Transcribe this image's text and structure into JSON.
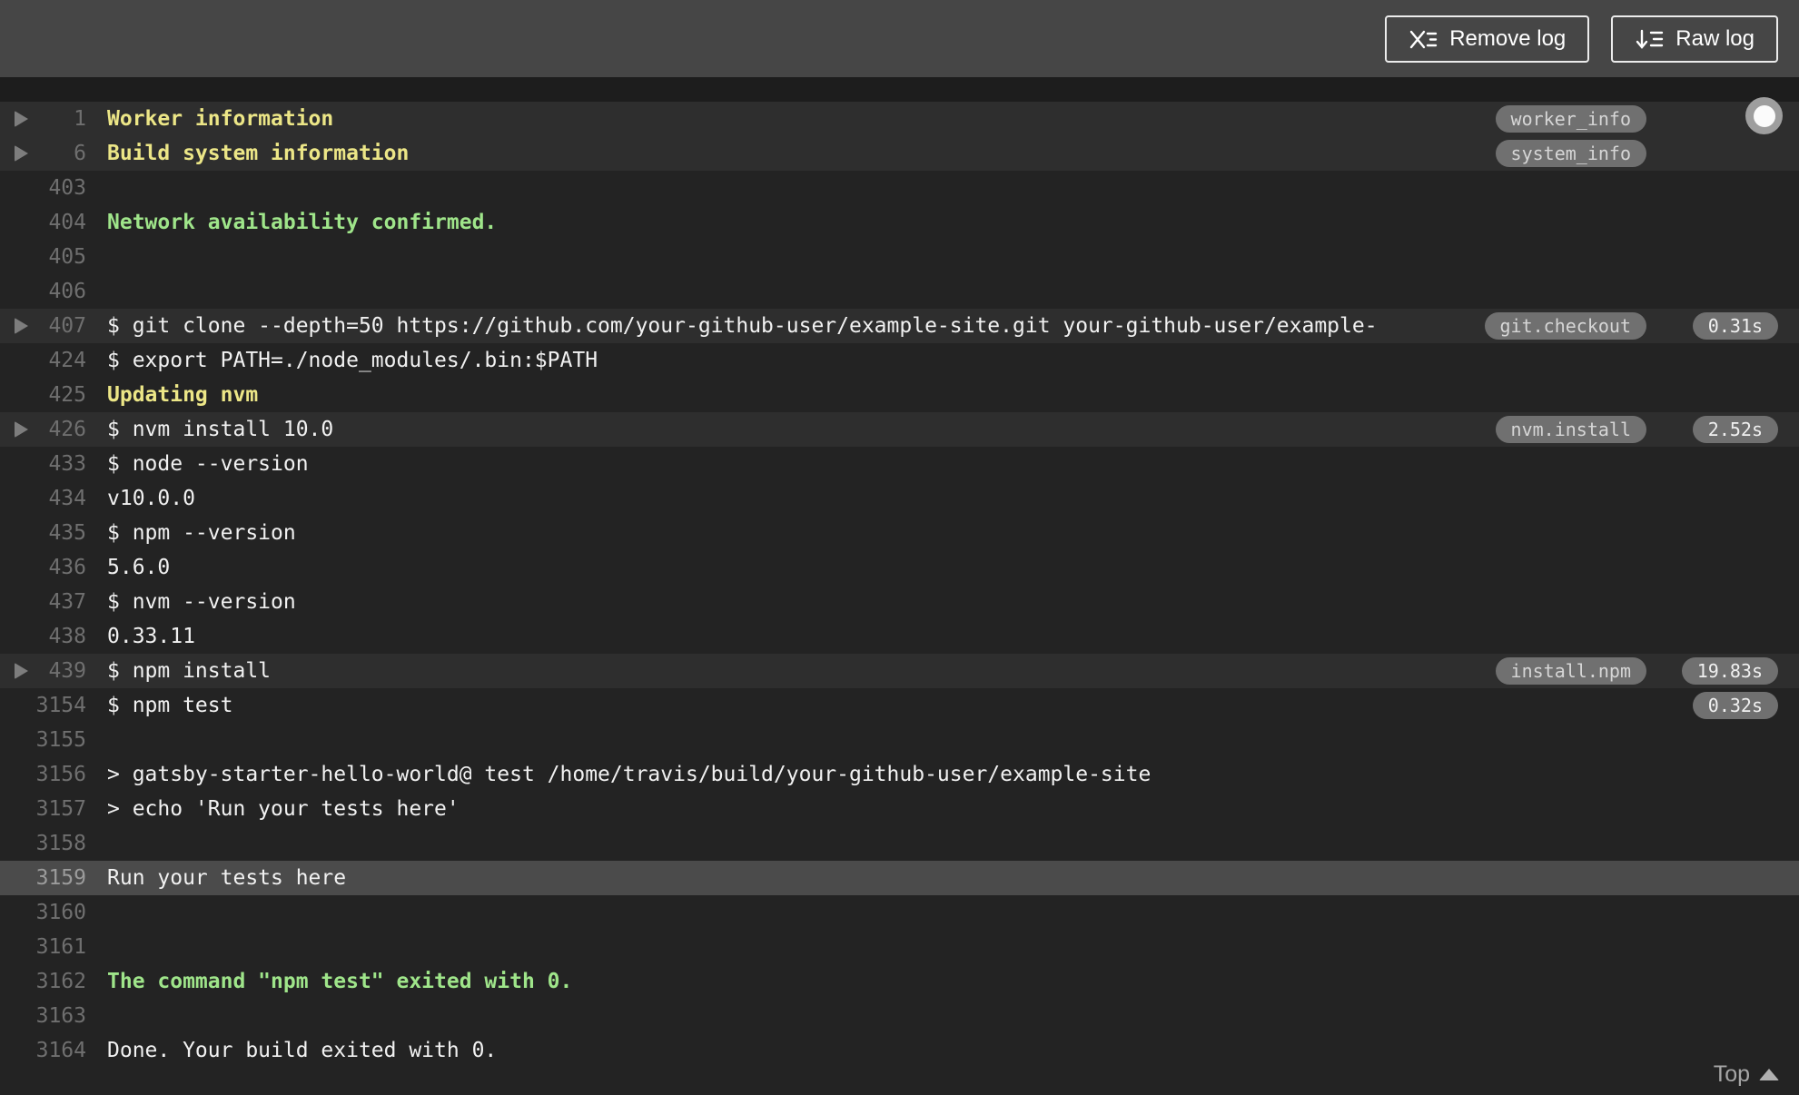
{
  "header": {
    "remove_log_label": "Remove log",
    "raw_log_label": "Raw log"
  },
  "footer": {
    "top_label": "Top"
  },
  "icons": {
    "remove_log": "x-list-icon",
    "raw_log": "arrow-down-list-icon",
    "fold": "triangle-right-icon",
    "top": "triangle-up-icon",
    "scroll_knob": "circle-knob-icon"
  },
  "colors": {
    "header_bg": "#464646",
    "log_bg": "#232323",
    "fold_row_bg": "#2e2e2e",
    "selected_row_bg": "#4b4b4b",
    "yellow_text": "#ece687",
    "green_text": "#9fe58a",
    "white_text": "#f1f1f1",
    "line_number": "#6f6f6f",
    "pill_bg": "#707070"
  },
  "log": {
    "lines": [
      {
        "num": "1",
        "text": "Worker information",
        "variant": "fold yellow",
        "fold": true,
        "tag": "worker_info"
      },
      {
        "num": "6",
        "text": "Build system information",
        "variant": "fold yellow",
        "fold": true,
        "tag": "system_info"
      },
      {
        "num": "403",
        "text": ""
      },
      {
        "num": "404",
        "text": "Network availability confirmed.",
        "variant": "green"
      },
      {
        "num": "405",
        "text": ""
      },
      {
        "num": "406",
        "text": ""
      },
      {
        "num": "407",
        "text": "$ git clone --depth=50 https://github.com/your-github-user/example-site.git your-github-user/example-",
        "variant": "fold",
        "fold": true,
        "tag": "git.checkout",
        "duration": "0.31s"
      },
      {
        "num": "424",
        "text": "$ export PATH=./node_modules/.bin:$PATH"
      },
      {
        "num": "425",
        "text": "Updating nvm",
        "variant": "yellow"
      },
      {
        "num": "426",
        "text": "$ nvm install 10.0",
        "variant": "fold",
        "fold": true,
        "tag": "nvm.install",
        "duration": "2.52s"
      },
      {
        "num": "433",
        "text": "$ node --version"
      },
      {
        "num": "434",
        "text": "v10.0.0"
      },
      {
        "num": "435",
        "text": "$ npm --version"
      },
      {
        "num": "436",
        "text": "5.6.0"
      },
      {
        "num": "437",
        "text": "$ nvm --version"
      },
      {
        "num": "438",
        "text": "0.33.11"
      },
      {
        "num": "439",
        "text": "$ npm install",
        "variant": "fold",
        "fold": true,
        "tag": "install.npm",
        "duration": "19.83s"
      },
      {
        "num": "3154",
        "text": "$ npm test",
        "duration": "0.32s"
      },
      {
        "num": "3155",
        "text": ""
      },
      {
        "num": "3156",
        "text": "> gatsby-starter-hello-world@ test /home/travis/build/your-github-user/example-site"
      },
      {
        "num": "3157",
        "text": "> echo 'Run your tests here'"
      },
      {
        "num": "3158",
        "text": ""
      },
      {
        "num": "3159",
        "text": "Run your tests here",
        "variant": "selected"
      },
      {
        "num": "3160",
        "text": ""
      },
      {
        "num": "3161",
        "text": ""
      },
      {
        "num": "3162",
        "text": "The command \"npm test\" exited with 0.",
        "variant": "green"
      },
      {
        "num": "3163",
        "text": ""
      },
      {
        "num": "3164",
        "text": "Done. Your build exited with 0."
      }
    ]
  }
}
